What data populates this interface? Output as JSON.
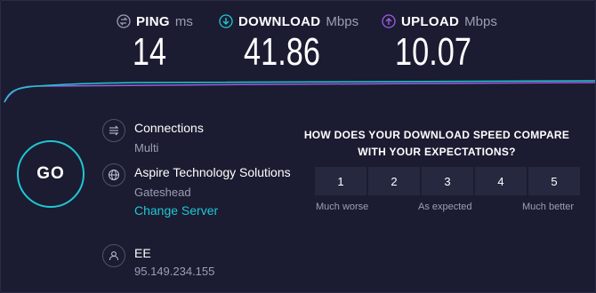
{
  "colors": {
    "background": "#1b1c31",
    "accent": "#1fc7d4",
    "download": "#1fc7d4",
    "upload": "#9b5de5",
    "muted": "#9c9fb4"
  },
  "metrics": {
    "ping": {
      "label": "PING",
      "unit": "ms",
      "value": "14",
      "icon": "ping-icon"
    },
    "download": {
      "label": "DOWNLOAD",
      "unit": "Mbps",
      "value": "41.86",
      "icon": "download-arrow-icon"
    },
    "upload": {
      "label": "UPLOAD",
      "unit": "Mbps",
      "value": "10.07",
      "icon": "upload-arrow-icon"
    }
  },
  "go_label": "GO",
  "connections": {
    "title": "Connections",
    "value": "Multi",
    "icon": "connections-icon"
  },
  "server": {
    "name": "Aspire Technology Solutions",
    "location": "Gateshead",
    "change_link": "Change Server",
    "icon": "globe-icon"
  },
  "provider": {
    "name": "EE",
    "ip": "95.149.234.155",
    "icon": "user-icon"
  },
  "survey": {
    "question": "HOW DOES YOUR DOWNLOAD SPEED COMPARE WITH YOUR EXPECTATIONS?",
    "options": [
      "1",
      "2",
      "3",
      "4",
      "5"
    ],
    "scale_low": "Much worse",
    "scale_mid": "As expected",
    "scale_high": "Much better"
  }
}
